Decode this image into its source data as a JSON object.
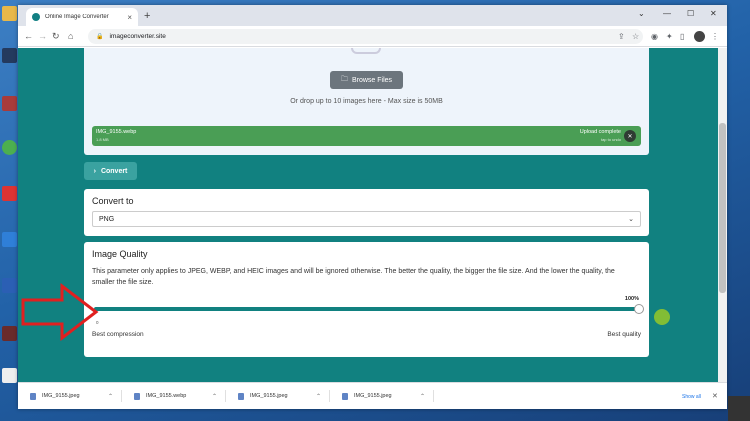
{
  "browser": {
    "tab_title": "Online Image Converter",
    "url": "imageconverter.site",
    "window_controls": [
      "⌄",
      "—",
      "☐",
      "✕"
    ]
  },
  "upload": {
    "browse_label": "Browse Files",
    "drop_text": "Or drop up to 10 images here - Max size is 50MB",
    "file_name": "IMG_9155.webp",
    "file_size": "1.8 MB",
    "status": "Upload complete",
    "undo_hint": "tap to undo"
  },
  "convert_button": "Convert",
  "convert_to": {
    "title": "Convert to",
    "selected": "PNG"
  },
  "image_quality": {
    "title": "Image Quality",
    "description": "This parameter only applies to JPEG, WEBP, and HEIC images and will be ignored otherwise. The better the quality, the bigger the file size. And the lower the quality, the smaller the file size.",
    "value_label": "100%",
    "value": 100,
    "min_label": "0",
    "left_label": "Best compression",
    "right_label": "Best quality"
  },
  "downloads": {
    "items": [
      "IMG_9155.jpeg",
      "IMG_9155.webp",
      "IMG_9155.jpeg",
      "IMG_9155.jpeg"
    ],
    "show_all": "Show all"
  },
  "colors": {
    "page_bg": "#118180",
    "success": "#4a9e55",
    "arrow": "#e02020"
  }
}
